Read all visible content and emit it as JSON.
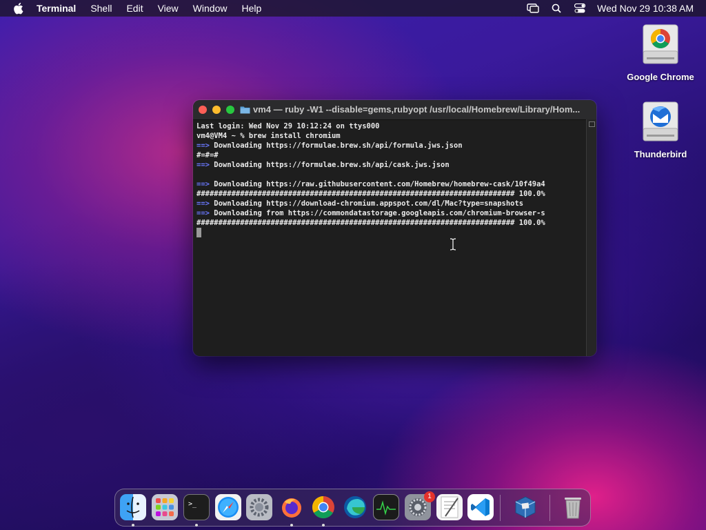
{
  "menubar": {
    "app_name": "Terminal",
    "menus": [
      "Shell",
      "Edit",
      "View",
      "Window",
      "Help"
    ],
    "clock": "Wed Nov 29  10:38 AM"
  },
  "desktop_icons": [
    {
      "label": "Google Chrome",
      "icon": "google-chrome-drive-icon"
    },
    {
      "label": "Thunderbird",
      "icon": "thunderbird-drive-icon"
    }
  ],
  "terminal": {
    "title": "vm4 — ruby -W1 --disable=gems,rubyopt /usr/local/Homebrew/Library/Hom...",
    "lines": [
      {
        "prefix": "",
        "text": "Last login: Wed Nov 29 10:12:24 on ttys000"
      },
      {
        "prefix": "",
        "text": "vm4@VM4 ~ % brew install chromium"
      },
      {
        "prefix": "==>",
        "text": " Downloading https://formulae.brew.sh/api/formula.jws.json"
      },
      {
        "prefix": "",
        "text": "#=#=#"
      },
      {
        "prefix": "==>",
        "text": " Downloading https://formulae.brew.sh/api/cask.jws.json"
      },
      {
        "prefix": "",
        "text": ""
      },
      {
        "prefix": "==>",
        "text": " Downloading https://raw.githubusercontent.com/Homebrew/homebrew-cask/10f49a4"
      },
      {
        "prefix": "",
        "text": "######################################################################### 100.0%"
      },
      {
        "prefix": "==>",
        "text": " Downloading https://download-chromium.appspot.com/dl/Mac?type=snapshots"
      },
      {
        "prefix": "==>",
        "text": " Downloading from https://commondatastorage.googleapis.com/chromium-browser-s"
      },
      {
        "prefix": "",
        "text": "######################################################################### 100.0%"
      }
    ]
  },
  "dock": {
    "apps": [
      "Finder",
      "Launchpad",
      "Terminal",
      "Safari",
      "System Preferences",
      "Firefox",
      "Google Chrome",
      "Microsoft Edge",
      "Activity Monitor",
      "System Settings",
      "TextEdit",
      "Visual Studio Code",
      "VirtualBox",
      "Trash"
    ],
    "system_settings_badge": "1"
  },
  "colors": {
    "arrow": "#6a78ff",
    "terminal_bg": "#1e1e1e",
    "close": "#fe5f57",
    "minimize": "#febc2e",
    "maximize": "#28c840"
  }
}
